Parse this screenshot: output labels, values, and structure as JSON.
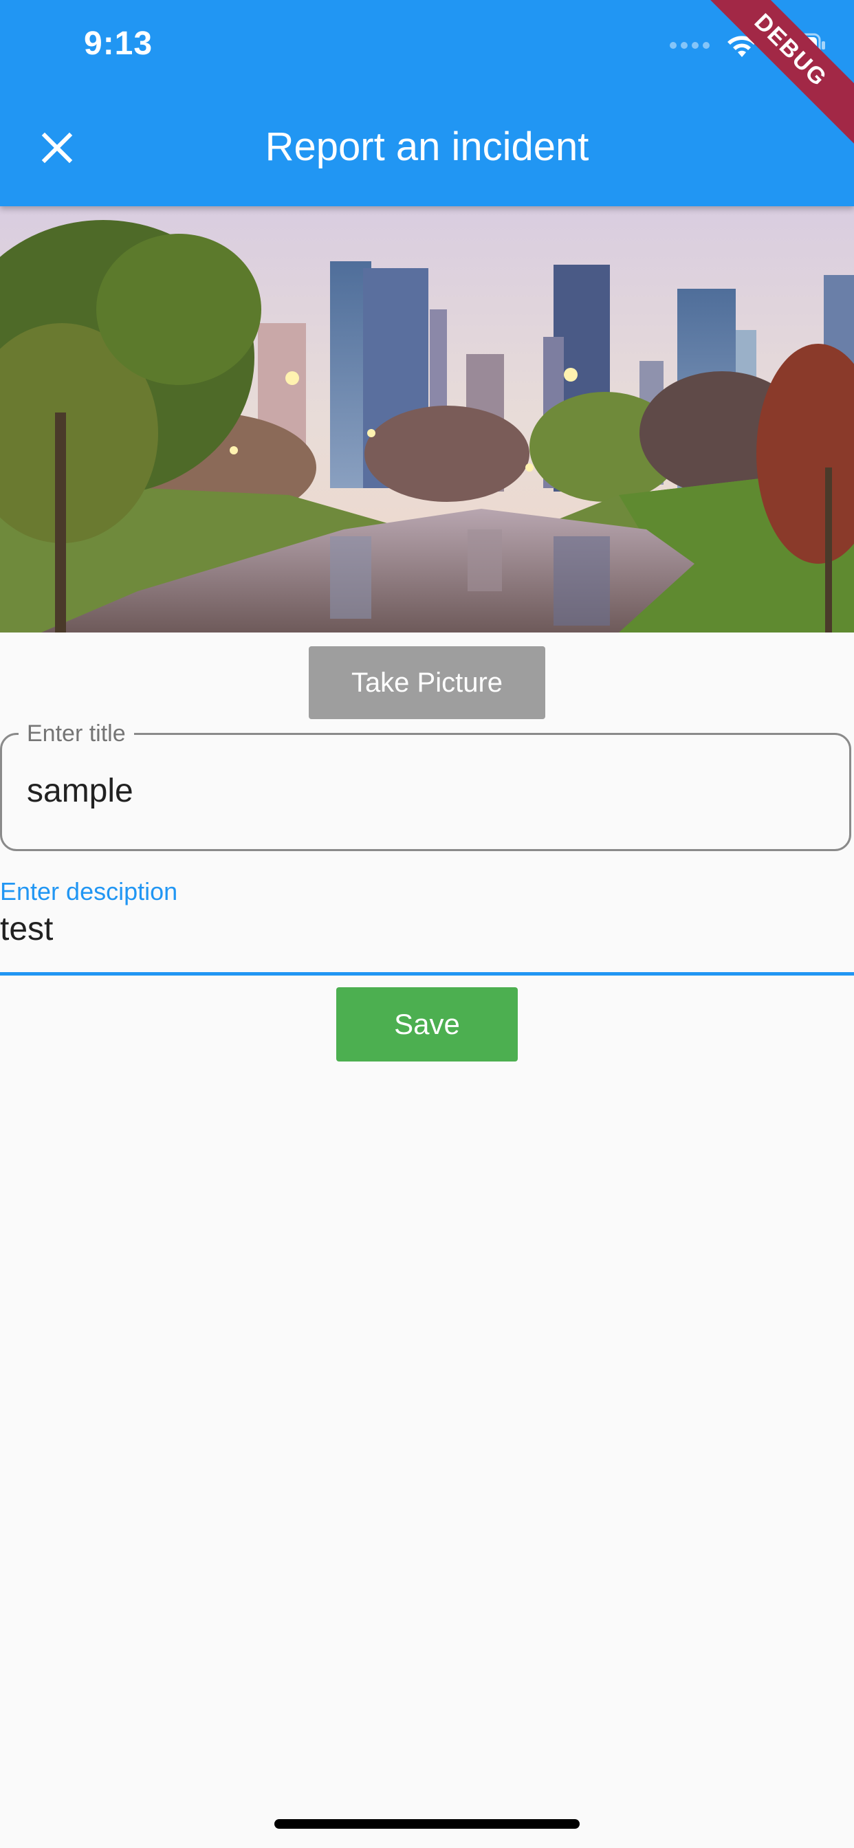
{
  "status_bar": {
    "time": "9:13",
    "icons": [
      "cellular-signal-icon",
      "wifi-icon",
      "battery-icon"
    ]
  },
  "debug_banner": "DEBUG",
  "app_bar": {
    "title": "Report an incident",
    "leading_icon": "close-icon",
    "background_color": "#2196f3"
  },
  "photo": {
    "description_icon": "city-park-photo"
  },
  "take_picture_button": {
    "label": "Take Picture",
    "color": "#9e9e9e"
  },
  "title_field": {
    "label": "Enter title",
    "value": "sample"
  },
  "description_field": {
    "label": "Enter desciption",
    "value": "test",
    "accent_color": "#2196f3"
  },
  "save_button": {
    "label": "Save",
    "color": "#4caf50"
  }
}
